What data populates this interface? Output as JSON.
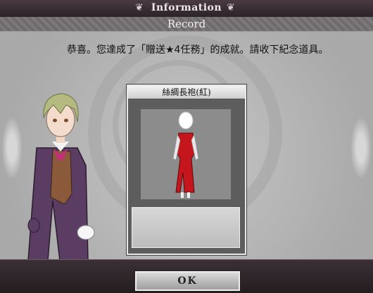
{
  "window": {
    "title": "Information",
    "subtitle": "Record"
  },
  "message": "恭喜。您達成了「贈送★4任務」的成就。請收下紀念道具。",
  "reward_card": {
    "item_name": "絲綢長袍(紅)",
    "item_color": "#c4161c"
  },
  "footer": {
    "ok_label": "OK"
  },
  "icons": {
    "title_ornament": "fleur-ornament-icon"
  }
}
